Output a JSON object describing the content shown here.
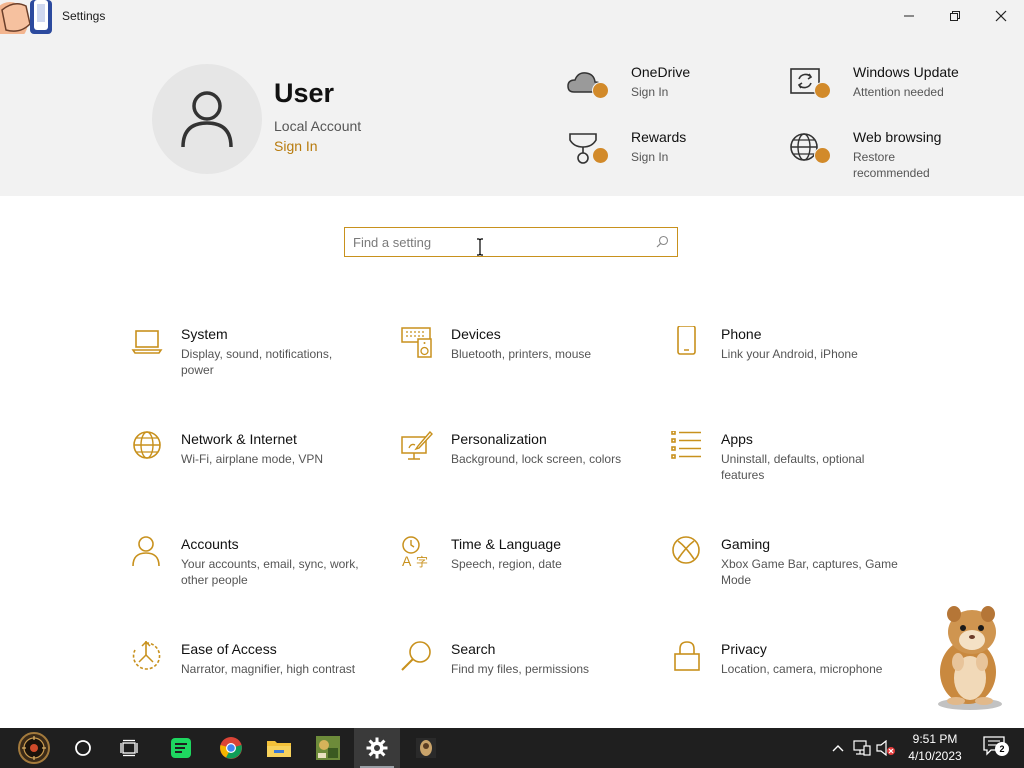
{
  "window": {
    "title": "Settings"
  },
  "header": {
    "user_name": "User",
    "account_type": "Local Account",
    "sign_in_label": "Sign In",
    "quick_items": [
      {
        "title": "OneDrive",
        "subtitle": "Sign In",
        "icon": "onedrive-cloud-icon"
      },
      {
        "title": "Windows Update",
        "subtitle": "Attention needed",
        "icon": "windows-update-icon"
      },
      {
        "title": "Rewards",
        "subtitle": "Sign In",
        "icon": "rewards-trophy-icon"
      },
      {
        "title": "Web browsing",
        "subtitle": "Restore recommended",
        "icon": "web-browsing-globe-icon"
      }
    ],
    "status_dot_color": "#d28a2a"
  },
  "search": {
    "placeholder": "Find a setting"
  },
  "categories": [
    {
      "title": "System",
      "description": "Display, sound, notifications, power",
      "icon": "laptop-icon"
    },
    {
      "title": "Devices",
      "description": "Bluetooth, printers, mouse",
      "icon": "keyboard-speaker-icon"
    },
    {
      "title": "Phone",
      "description": "Link your Android, iPhone",
      "icon": "phone-icon"
    },
    {
      "title": "Network & Internet",
      "description": "Wi-Fi, airplane mode, VPN",
      "icon": "globe-icon"
    },
    {
      "title": "Personalization",
      "description": "Background, lock screen, colors",
      "icon": "paint-brush-icon"
    },
    {
      "title": "Apps",
      "description": "Uninstall, defaults, optional features",
      "icon": "apps-list-icon"
    },
    {
      "title": "Accounts",
      "description": "Your accounts, email, sync, work, other people",
      "icon": "person-icon"
    },
    {
      "title": "Time & Language",
      "description": "Speech, region, date",
      "icon": "time-language-icon"
    },
    {
      "title": "Gaming",
      "description": "Xbox Game Bar, captures, Game Mode",
      "icon": "xbox-icon"
    },
    {
      "title": "Ease of Access",
      "description": "Narrator, magnifier, high contrast",
      "icon": "ease-of-access-icon"
    },
    {
      "title": "Search",
      "description": "Find my files, permissions",
      "icon": "magnifier-icon"
    },
    {
      "title": "Privacy",
      "description": "Location, camera, microphone",
      "icon": "lock-icon"
    }
  ],
  "accent_color": "#c8911d",
  "taskbar": {
    "time": "9:51 PM",
    "date": "4/10/2023",
    "notification_count": "2"
  }
}
